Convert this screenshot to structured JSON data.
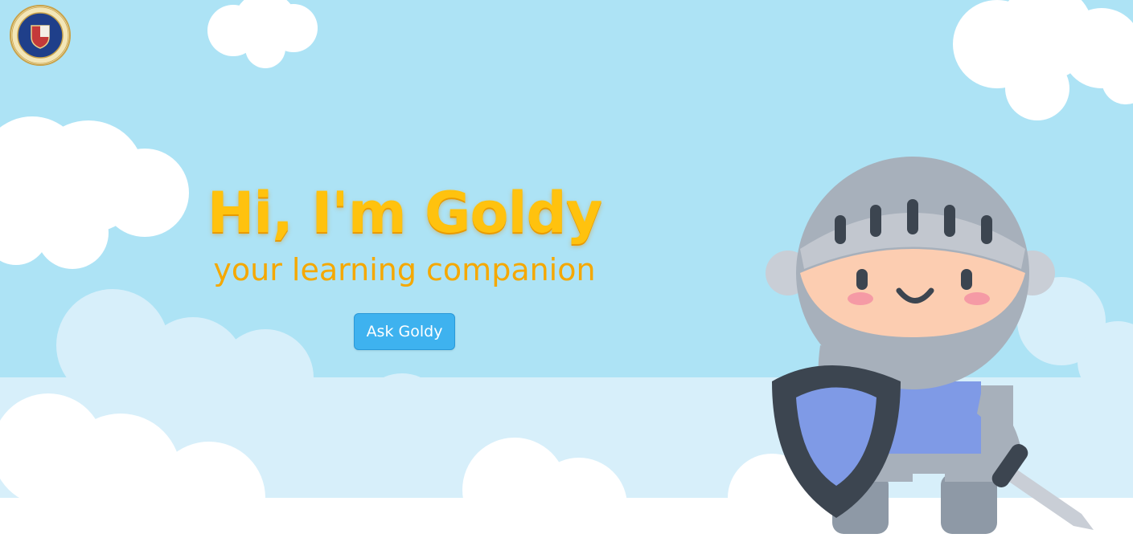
{
  "hero": {
    "title": "Hi, I'm Goldy",
    "subtitle": "your learning companion",
    "ask_button_label": "Ask Goldy"
  },
  "logo": {
    "seal_text_top": "OPERIBUS · REGNUM",
    "seal_text_bottom": "ATENEO DE NAGA",
    "name": "ateneo-de-naga-seal"
  },
  "colors": {
    "sky": "#ade3f5",
    "title_gold": "#ffc20e",
    "button_blue": "#3eb2ef"
  },
  "mascot": {
    "name": "knight-mascot"
  }
}
